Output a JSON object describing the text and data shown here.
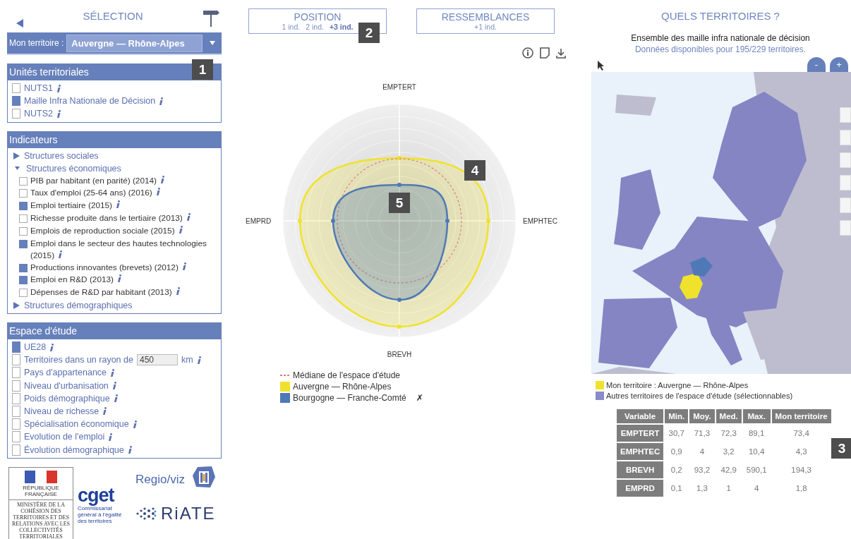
{
  "selection": {
    "title": "SÉLECTION"
  },
  "territory_select": {
    "label": "Mon territoire :",
    "value": "Auvergne — Rhône-Alpes"
  },
  "units": {
    "title": "Unités territoriales",
    "items": [
      {
        "label": "NUTS1",
        "checked": false
      },
      {
        "label": "Maille Infra Nationale de Décision",
        "checked": true
      },
      {
        "label": "NUTS2",
        "checked": false
      }
    ]
  },
  "indicators": {
    "title": "Indicateurs",
    "groups": [
      {
        "label": "Structures sociales",
        "expanded": false
      },
      {
        "label": "Structures économiques",
        "expanded": true,
        "children": [
          {
            "label": "PIB par habitant (en parité) (2014)",
            "checked": false
          },
          {
            "label": "Taux d'emploi (25-64 ans) (2016)",
            "checked": false
          },
          {
            "label": "Emploi tertiaire (2015)",
            "checked": true
          },
          {
            "label": "Richesse produite dans le tertiaire (2013)",
            "checked": false
          },
          {
            "label": "Emplois de reproduction sociale (2015)",
            "checked": false
          },
          {
            "label": "Emploi dans le secteur des hautes technologies (2015)",
            "checked": true
          },
          {
            "label": "Productions innovantes (brevets) (2012)",
            "checked": true
          },
          {
            "label": "Emploi en R&D (2013)",
            "checked": true
          },
          {
            "label": "Dépenses de R&D par habitant (2013)",
            "checked": false
          }
        ]
      },
      {
        "label": "Structures démographiques",
        "expanded": false
      }
    ]
  },
  "study_space": {
    "title": "Espace d'étude",
    "items": [
      {
        "kind": "plain",
        "label": "UE28",
        "checked": true
      },
      {
        "kind": "radius",
        "label": "Territoires dans un rayon de",
        "value": "450",
        "unit": "km",
        "checked": false
      },
      {
        "kind": "plain",
        "label": "Pays d'appartenance",
        "checked": false
      },
      {
        "kind": "plain",
        "label": "Niveau d'urbanisation",
        "checked": false
      },
      {
        "kind": "plain",
        "label": "Poids démographique",
        "checked": false
      },
      {
        "kind": "plain",
        "label": "Niveau de richesse",
        "checked": false
      },
      {
        "kind": "plain",
        "label": "Spécialisation économique",
        "checked": false
      },
      {
        "kind": "plain",
        "label": "Evolution de l'emploi",
        "checked": false
      },
      {
        "kind": "plain",
        "label": "Évolution démographique",
        "checked": false
      }
    ]
  },
  "logos": {
    "republic": "RÉPUBLIQUE FRANÇAISE",
    "ministry": "MINISTÈRE DE LA COHÉSION DES TERRITOIRES ET DES RELATIONS AVEC LES COLLECTIVITÉS TERRITORIALES",
    "cget": "cget",
    "cget_sub": "Commissariat général à l'égalité des territoires",
    "regioviz": "Regio/viz",
    "riate": "RiATE"
  },
  "tabs": [
    {
      "title": "POSITION",
      "options": [
        {
          "label": "1 ind.",
          "selected": false
        },
        {
          "label": "2 ind.",
          "selected": false
        },
        {
          "label": "+3 ind.",
          "selected": true
        }
      ]
    },
    {
      "title": "RESSEMBLANCES",
      "options": [
        {
          "label": "+1 ind.",
          "selected": false
        }
      ]
    }
  ],
  "radar": {
    "axes": [
      "EMPTERT",
      "EMPHTEC",
      "BREVH",
      "EMPRD"
    ]
  },
  "legend": [
    {
      "kind": "median",
      "label": "Médiane de l'espace d'étude",
      "color": "#e07a7a"
    },
    {
      "kind": "swatch",
      "label": "Auvergne — Rhône-Alpes",
      "color": "#f0e22c"
    },
    {
      "kind": "swatch",
      "label": "Bourgogne — Franche-Comté",
      "color": "#4f79b6",
      "remove": "✗"
    }
  ],
  "territories": {
    "title": "QUELS TERRITOIRES ?",
    "subtitle": "Ensemble des maille infra nationale de décision",
    "note": "Données disponibles pour 195/229 territoires.",
    "zoom_out": "-",
    "zoom_in": "+"
  },
  "map_legend": [
    {
      "label": "Mon territoire : Auvergne — Rhône-Alpes",
      "color": "#f0e22c"
    },
    {
      "label": "Autres territoires de l'espace d'étude (sélectionnables)",
      "color": "#8b8bc6"
    }
  ],
  "table": {
    "columns": [
      "Variable",
      "Min.",
      "Moy.",
      "Med.",
      "Max.",
      "Mon territoire"
    ],
    "rows": [
      [
        "EMPTERT",
        "30,7",
        "71,3",
        "72,3",
        "89,1",
        "73,4"
      ],
      [
        "EMPHTEC",
        "0,9",
        "4",
        "3,2",
        "10,4",
        "4,3"
      ],
      [
        "BREVH",
        "0,2",
        "93,2",
        "42,9",
        "590,1",
        "194,3"
      ],
      [
        "EMPRD",
        "0,1",
        "1,3",
        "1",
        "4",
        "1,8"
      ]
    ]
  },
  "annotations": [
    "1",
    "2",
    "3",
    "4",
    "5"
  ]
}
